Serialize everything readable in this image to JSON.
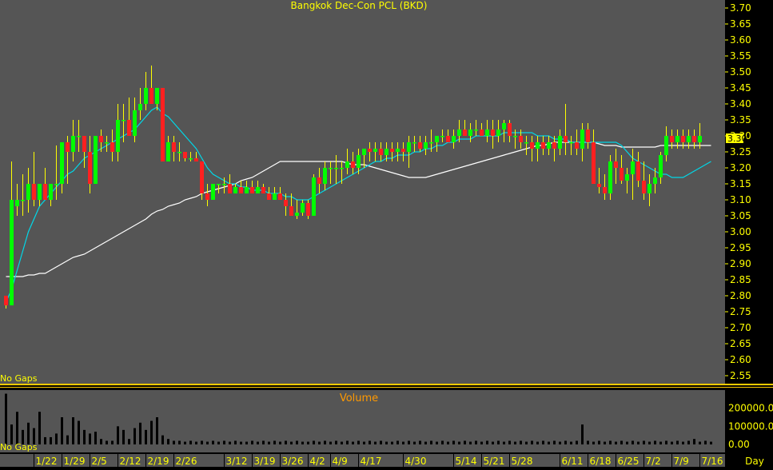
{
  "chart_data": {
    "type": "candlestick",
    "title": "Bangkok Dec-Con PCL (BKD)",
    "last_price_label": "3.30",
    "no_gaps_label": "No Gaps",
    "price_axis": {
      "ylim": [
        2.525,
        3.725
      ],
      "ticks": [
        3.7,
        3.65,
        3.6,
        3.55,
        3.5,
        3.45,
        3.4,
        3.35,
        3.3,
        3.25,
        3.2,
        3.15,
        3.1,
        3.05,
        3.0,
        2.95,
        2.9,
        2.85,
        2.8,
        2.75,
        2.7,
        2.65,
        2.6,
        2.55
      ],
      "tick_labels": [
        "3.70",
        "3.65",
        "3.60",
        "3.55",
        "3.50",
        "3.45",
        "3.40",
        "3.35",
        "3.30",
        "3.25",
        "3.20",
        "3.15",
        "3.10",
        "3.05",
        "3.00",
        "2.95",
        "2.90",
        "2.85",
        "2.80",
        "2.75",
        "2.70",
        "2.65",
        "2.60",
        "2.55"
      ]
    },
    "volume_panel": {
      "title": "Volume",
      "ylim": [
        0,
        300000
      ],
      "tick_values": [
        200000,
        100000,
        0
      ],
      "tick_labels": [
        "200000.0",
        "100000.0",
        "0.00"
      ]
    },
    "x_axis": {
      "unit_label": "Day",
      "tick_labels": [
        {
          "label": "1/22",
          "index": 5
        },
        {
          "label": "1/29",
          "index": 10
        },
        {
          "label": "2/5",
          "index": 15
        },
        {
          "label": "2/12",
          "index": 20
        },
        {
          "label": "2/19",
          "index": 25
        },
        {
          "label": "2/26",
          "index": 30
        },
        {
          "label": "3/12",
          "index": 39
        },
        {
          "label": "3/19",
          "index": 44
        },
        {
          "label": "3/26",
          "index": 49
        },
        {
          "label": "4/2",
          "index": 54
        },
        {
          "label": "4/9",
          "index": 58
        },
        {
          "label": "4/17",
          "index": 63
        },
        {
          "label": "4/30",
          "index": 71
        },
        {
          "label": "5/14",
          "index": 80
        },
        {
          "label": "5/21",
          "index": 85
        },
        {
          "label": "5/28",
          "index": 90
        },
        {
          "label": "6/11",
          "index": 99
        },
        {
          "label": "6/18",
          "index": 104
        },
        {
          "label": "6/25",
          "index": 109
        },
        {
          "label": "7/2",
          "index": 114
        },
        {
          "label": "7/9",
          "index": 119
        },
        {
          "label": "7/16",
          "index": 124
        }
      ]
    },
    "ohlc": [
      [
        2.8,
        2.8,
        2.76,
        2.77
      ],
      [
        2.77,
        3.22,
        2.77,
        3.1
      ],
      [
        3.08,
        3.15,
        3.05,
        3.1
      ],
      [
        3.1,
        3.18,
        3.05,
        3.1
      ],
      [
        3.1,
        3.2,
        3.06,
        3.15
      ],
      [
        3.15,
        3.25,
        3.08,
        3.1
      ],
      [
        3.1,
        3.15,
        3.08,
        3.15
      ],
      [
        3.15,
        3.2,
        3.1,
        3.1
      ],
      [
        3.1,
        3.15,
        3.08,
        3.15
      ],
      [
        3.15,
        3.27,
        3.1,
        3.15
      ],
      [
        3.15,
        3.28,
        3.12,
        3.28
      ],
      [
        3.28,
        3.3,
        3.15,
        3.25
      ],
      [
        3.25,
        3.35,
        3.22,
        3.3
      ],
      [
        3.3,
        3.35,
        3.25,
        3.3
      ],
      [
        3.3,
        3.3,
        3.2,
        3.25
      ],
      [
        3.25,
        3.3,
        3.12,
        3.15
      ],
      [
        3.15,
        3.3,
        3.15,
        3.3
      ],
      [
        3.3,
        3.32,
        3.25,
        3.28
      ],
      [
        3.28,
        3.3,
        3.25,
        3.28
      ],
      [
        3.28,
        3.32,
        3.22,
        3.25
      ],
      [
        3.25,
        3.4,
        3.22,
        3.35
      ],
      [
        3.35,
        3.4,
        3.28,
        3.35
      ],
      [
        3.35,
        3.42,
        3.3,
        3.3
      ],
      [
        3.3,
        3.42,
        3.28,
        3.38
      ],
      [
        3.38,
        3.45,
        3.35,
        3.4
      ],
      [
        3.4,
        3.5,
        3.38,
        3.45
      ],
      [
        3.45,
        3.52,
        3.4,
        3.4
      ],
      [
        3.4,
        3.45,
        3.38,
        3.45
      ],
      [
        3.45,
        3.45,
        3.22,
        3.22
      ],
      [
        3.22,
        3.3,
        3.22,
        3.28
      ],
      [
        3.28,
        3.3,
        3.22,
        3.25
      ],
      [
        3.25,
        3.28,
        3.22,
        3.25
      ],
      [
        3.25,
        3.25,
        3.22,
        3.23
      ],
      [
        3.23,
        3.25,
        3.22,
        3.23
      ],
      [
        3.23,
        3.25,
        3.22,
        3.22
      ],
      [
        3.22,
        3.22,
        3.1,
        3.12
      ],
      [
        3.12,
        3.15,
        3.08,
        3.1
      ],
      [
        3.1,
        3.15,
        3.1,
        3.15
      ],
      [
        3.15,
        3.15,
        3.12,
        3.15
      ],
      [
        3.15,
        3.17,
        3.12,
        3.15
      ],
      [
        3.15,
        3.18,
        3.12,
        3.12
      ],
      [
        3.12,
        3.15,
        3.12,
        3.14
      ],
      [
        3.14,
        3.16,
        3.12,
        3.12
      ],
      [
        3.12,
        3.16,
        3.12,
        3.14
      ],
      [
        3.14,
        3.16,
        3.12,
        3.12
      ],
      [
        3.12,
        3.16,
        3.12,
        3.14
      ],
      [
        3.14,
        3.15,
        3.12,
        3.12
      ],
      [
        3.12,
        3.14,
        3.1,
        3.1
      ],
      [
        3.1,
        3.14,
        3.1,
        3.12
      ],
      [
        3.12,
        3.14,
        3.1,
        3.1
      ],
      [
        3.1,
        3.12,
        3.05,
        3.08
      ],
      [
        3.08,
        3.12,
        3.05,
        3.05
      ],
      [
        3.05,
        3.1,
        3.04,
        3.06
      ],
      [
        3.06,
        3.1,
        3.05,
        3.09
      ],
      [
        3.09,
        3.1,
        3.04,
        3.05
      ],
      [
        3.05,
        3.18,
        3.05,
        3.17
      ],
      [
        3.17,
        3.2,
        3.12,
        3.15
      ],
      [
        3.15,
        3.22,
        3.13,
        3.2
      ],
      [
        3.2,
        3.22,
        3.15,
        3.2
      ],
      [
        3.2,
        3.24,
        3.15,
        3.2
      ],
      [
        3.2,
        3.22,
        3.15,
        3.2
      ],
      [
        3.2,
        3.26,
        3.18,
        3.22
      ],
      [
        3.22,
        3.25,
        3.18,
        3.2
      ],
      [
        3.2,
        3.26,
        3.18,
        3.24
      ],
      [
        3.24,
        3.26,
        3.2,
        3.26
      ],
      [
        3.26,
        3.28,
        3.22,
        3.25
      ],
      [
        3.25,
        3.28,
        3.22,
        3.26
      ],
      [
        3.26,
        3.28,
        3.22,
        3.24
      ],
      [
        3.24,
        3.28,
        3.22,
        3.26
      ],
      [
        3.26,
        3.28,
        3.22,
        3.25
      ],
      [
        3.25,
        3.28,
        3.22,
        3.26
      ],
      [
        3.26,
        3.28,
        3.22,
        3.25
      ],
      [
        3.25,
        3.3,
        3.2,
        3.28
      ],
      [
        3.28,
        3.3,
        3.25,
        3.28
      ],
      [
        3.28,
        3.3,
        3.25,
        3.26
      ],
      [
        3.26,
        3.3,
        3.24,
        3.28
      ],
      [
        3.28,
        3.32,
        3.25,
        3.28
      ],
      [
        3.28,
        3.3,
        3.25,
        3.3
      ],
      [
        3.3,
        3.32,
        3.28,
        3.3
      ],
      [
        3.3,
        3.32,
        3.28,
        3.28
      ],
      [
        3.28,
        3.32,
        3.26,
        3.3
      ],
      [
        3.3,
        3.35,
        3.28,
        3.32
      ],
      [
        3.32,
        3.35,
        3.3,
        3.3
      ],
      [
        3.3,
        3.34,
        3.28,
        3.32
      ],
      [
        3.32,
        3.35,
        3.3,
        3.32
      ],
      [
        3.32,
        3.34,
        3.3,
        3.3
      ],
      [
        3.3,
        3.35,
        3.28,
        3.32
      ],
      [
        3.32,
        3.35,
        3.26,
        3.3
      ],
      [
        3.3,
        3.35,
        3.28,
        3.32
      ],
      [
        3.32,
        3.35,
        3.28,
        3.34
      ],
      [
        3.34,
        3.35,
        3.28,
        3.3
      ],
      [
        3.3,
        3.32,
        3.26,
        3.3
      ],
      [
        3.3,
        3.32,
        3.26,
        3.28
      ],
      [
        3.28,
        3.3,
        3.24,
        3.28
      ],
      [
        3.28,
        3.3,
        3.22,
        3.26
      ],
      [
        3.26,
        3.3,
        3.22,
        3.28
      ],
      [
        3.28,
        3.3,
        3.24,
        3.26
      ],
      [
        3.26,
        3.3,
        3.24,
        3.28
      ],
      [
        3.28,
        3.3,
        3.22,
        3.26
      ],
      [
        3.26,
        3.32,
        3.24,
        3.3
      ],
      [
        3.3,
        3.4,
        3.24,
        3.28
      ],
      [
        3.28,
        3.3,
        3.24,
        3.28
      ],
      [
        3.28,
        3.32,
        3.24,
        3.26
      ],
      [
        3.26,
        3.34,
        3.22,
        3.32
      ],
      [
        3.32,
        3.34,
        3.26,
        3.28
      ],
      [
        3.28,
        3.32,
        3.18,
        3.15
      ],
      [
        3.15,
        3.2,
        3.12,
        3.14
      ],
      [
        3.14,
        3.18,
        3.1,
        3.12
      ],
      [
        3.12,
        3.24,
        3.1,
        3.22
      ],
      [
        3.22,
        3.26,
        3.15,
        3.2
      ],
      [
        3.2,
        3.24,
        3.15,
        3.16
      ],
      [
        3.16,
        3.2,
        3.12,
        3.18
      ],
      [
        3.18,
        3.26,
        3.1,
        3.22
      ],
      [
        3.22,
        3.25,
        3.14,
        3.16
      ],
      [
        3.16,
        3.22,
        3.1,
        3.12
      ],
      [
        3.12,
        3.18,
        3.08,
        3.15
      ],
      [
        3.15,
        3.2,
        3.12,
        3.17
      ],
      [
        3.17,
        3.25,
        3.15,
        3.24
      ],
      [
        3.24,
        3.33,
        3.22,
        3.3
      ],
      [
        3.3,
        3.32,
        3.26,
        3.28
      ],
      [
        3.28,
        3.32,
        3.26,
        3.3
      ],
      [
        3.3,
        3.32,
        3.26,
        3.28
      ],
      [
        3.28,
        3.32,
        3.26,
        3.3
      ],
      [
        3.3,
        3.32,
        3.26,
        3.28
      ],
      [
        3.28,
        3.34,
        3.26,
        3.3
      ]
    ],
    "ma_short": [
      2.78,
      2.82,
      2.88,
      2.94,
      3.0,
      3.04,
      3.08,
      3.1,
      3.12,
      3.14,
      3.16,
      3.18,
      3.19,
      3.21,
      3.23,
      3.24,
      3.25,
      3.26,
      3.27,
      3.28,
      3.29,
      3.3,
      3.31,
      3.32,
      3.34,
      3.36,
      3.38,
      3.39,
      3.37,
      3.36,
      3.34,
      3.32,
      3.3,
      3.28,
      3.26,
      3.23,
      3.2,
      3.18,
      3.17,
      3.16,
      3.15,
      3.15,
      3.14,
      3.14,
      3.13,
      3.13,
      3.13,
      3.12,
      3.12,
      3.12,
      3.11,
      3.11,
      3.1,
      3.1,
      3.1,
      3.11,
      3.12,
      3.13,
      3.14,
      3.15,
      3.16,
      3.17,
      3.18,
      3.19,
      3.2,
      3.21,
      3.22,
      3.22,
      3.23,
      3.23,
      3.24,
      3.24,
      3.24,
      3.25,
      3.25,
      3.26,
      3.26,
      3.27,
      3.27,
      3.28,
      3.28,
      3.29,
      3.29,
      3.29,
      3.3,
      3.3,
      3.3,
      3.3,
      3.3,
      3.31,
      3.31,
      3.31,
      3.31,
      3.31,
      3.31,
      3.3,
      3.3,
      3.3,
      3.29,
      3.29,
      3.29,
      3.28,
      3.28,
      3.28,
      3.28,
      3.28,
      3.28,
      3.28,
      3.28,
      3.28,
      3.27,
      3.25,
      3.23,
      3.22,
      3.21,
      3.2,
      3.19,
      3.18,
      3.18,
      3.17,
      3.17,
      3.17,
      3.18,
      3.19,
      3.2,
      3.21,
      3.22
    ],
    "ma_long": [
      2.86,
      2.86,
      2.86,
      2.86,
      2.865,
      2.865,
      2.87,
      2.87,
      2.88,
      2.89,
      2.9,
      2.91,
      2.92,
      2.925,
      2.93,
      2.94,
      2.95,
      2.96,
      2.97,
      2.98,
      2.99,
      3.0,
      3.01,
      3.02,
      3.03,
      3.04,
      3.055,
      3.065,
      3.07,
      3.08,
      3.085,
      3.09,
      3.1,
      3.105,
      3.11,
      3.12,
      3.125,
      3.13,
      3.135,
      3.14,
      3.145,
      3.15,
      3.16,
      3.165,
      3.17,
      3.18,
      3.19,
      3.2,
      3.21,
      3.22,
      3.22,
      3.22,
      3.22,
      3.22,
      3.22,
      3.22,
      3.22,
      3.22,
      3.22,
      3.22,
      3.22,
      3.215,
      3.21,
      3.21,
      3.21,
      3.205,
      3.2,
      3.195,
      3.19,
      3.185,
      3.18,
      3.175,
      3.17,
      3.17,
      3.17,
      3.17,
      3.175,
      3.18,
      3.185,
      3.19,
      3.195,
      3.2,
      3.205,
      3.21,
      3.215,
      3.22,
      3.225,
      3.23,
      3.235,
      3.24,
      3.245,
      3.25,
      3.255,
      3.26,
      3.265,
      3.27,
      3.27,
      3.275,
      3.28,
      3.28,
      3.28,
      3.28,
      3.28,
      3.28,
      3.28,
      3.28,
      3.275,
      3.27,
      3.27,
      3.27,
      3.265,
      3.265,
      3.265,
      3.265,
      3.265,
      3.265,
      3.265,
      3.27,
      3.27,
      3.27,
      3.27,
      3.27,
      3.27,
      3.27,
      3.27,
      3.27,
      3.27
    ],
    "volume": [
      280000,
      110000,
      180000,
      80000,
      120000,
      90000,
      180000,
      40000,
      40000,
      60000,
      150000,
      50000,
      150000,
      130000,
      80000,
      60000,
      70000,
      30000,
      20000,
      20000,
      100000,
      80000,
      30000,
      90000,
      120000,
      80000,
      130000,
      150000,
      50000,
      30000,
      20000,
      20000,
      15000,
      20000,
      15000,
      20000,
      15000,
      20000,
      15000,
      20000,
      15000,
      20000,
      15000,
      15000,
      20000,
      15000,
      20000,
      15000,
      20000,
      15000,
      20000,
      15000,
      20000,
      15000,
      15000,
      20000,
      15000,
      20000,
      15000,
      20000,
      15000,
      20000,
      15000,
      20000,
      15000,
      20000,
      15000,
      20000,
      15000,
      15000,
      20000,
      15000,
      20000,
      15000,
      20000,
      15000,
      20000,
      15000,
      20000,
      15000,
      20000,
      15000,
      20000,
      15000,
      20000,
      15000,
      20000,
      15000,
      20000,
      15000,
      20000,
      15000,
      20000,
      15000,
      20000,
      15000,
      20000,
      15000,
      20000,
      15000,
      20000,
      15000,
      20000,
      110000,
      20000,
      15000,
      20000,
      15000,
      20000,
      15000,
      20000,
      15000,
      20000,
      15000,
      20000,
      15000,
      20000,
      15000,
      20000,
      15000,
      20000,
      15000,
      20000,
      30000,
      15000,
      20000,
      15000
    ]
  },
  "colors": {
    "background": "#000000",
    "panel": "#555555",
    "up_candle": "#00ff00",
    "down_candle": "#ff2020",
    "wick": "#ffff00",
    "ma_short": "#00d8e8",
    "ma_long": "#ffffff",
    "volume_bar": "#000000",
    "title_text": "#ffff00",
    "volume_title": "#ff9900",
    "separator": "#ffcc00"
  }
}
